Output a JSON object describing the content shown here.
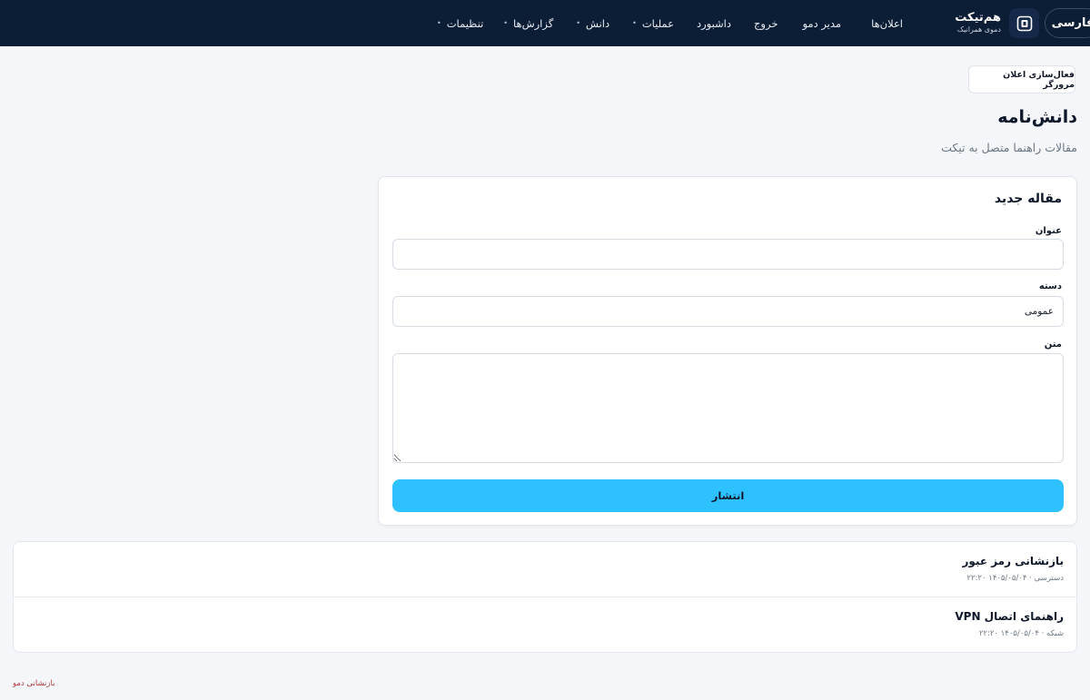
{
  "nav": {
    "language": "فارسی",
    "brand_name": "هم‌تیکت",
    "brand_subtitle": "دموی همرانیک",
    "items": [
      {
        "label": "اعلان‌ها"
      },
      {
        "label": "مدیر دمو"
      },
      {
        "label": "خروج"
      },
      {
        "label": "داشبورد"
      },
      {
        "label": "عملیات",
        "dot": "•"
      },
      {
        "label": "دانش",
        "dot": "•"
      },
      {
        "label": "گزارش‌ها",
        "dot": "•"
      },
      {
        "label": "تنظیمات",
        "dot": "•"
      }
    ]
  },
  "header": {
    "announce_button": "فعال‌سازی اعلان مرورگر",
    "title": "دانش‌نامه",
    "subtitle": "مقالات راهنما متصل به تیکت"
  },
  "form": {
    "title": "مقاله جدید",
    "title_label": "عنوان",
    "title_value": "",
    "category_label": "دسته",
    "category_value": "عمومی",
    "body_label": "متن",
    "body_value": "",
    "publish_label": "انتشار"
  },
  "articles": [
    {
      "title": "بازنشانی رمز عبور",
      "meta": "دسترسی · ۱۴۰۵/۰۵/۰۴ ۲۲:۲۰"
    },
    {
      "title": "راهنمای اتصال VPN",
      "meta": "شبکه · ۱۴۰۵/۰۵/۰۴ ۲۲:۲۰"
    }
  ],
  "footer": {
    "reset_demo": "بازنشانی دمو"
  },
  "colors": {
    "nav_bg": "#0c1d36",
    "accent": "#2ec1ff",
    "page_bg": "#f4f6f9",
    "danger_link": "#b23a3a"
  }
}
